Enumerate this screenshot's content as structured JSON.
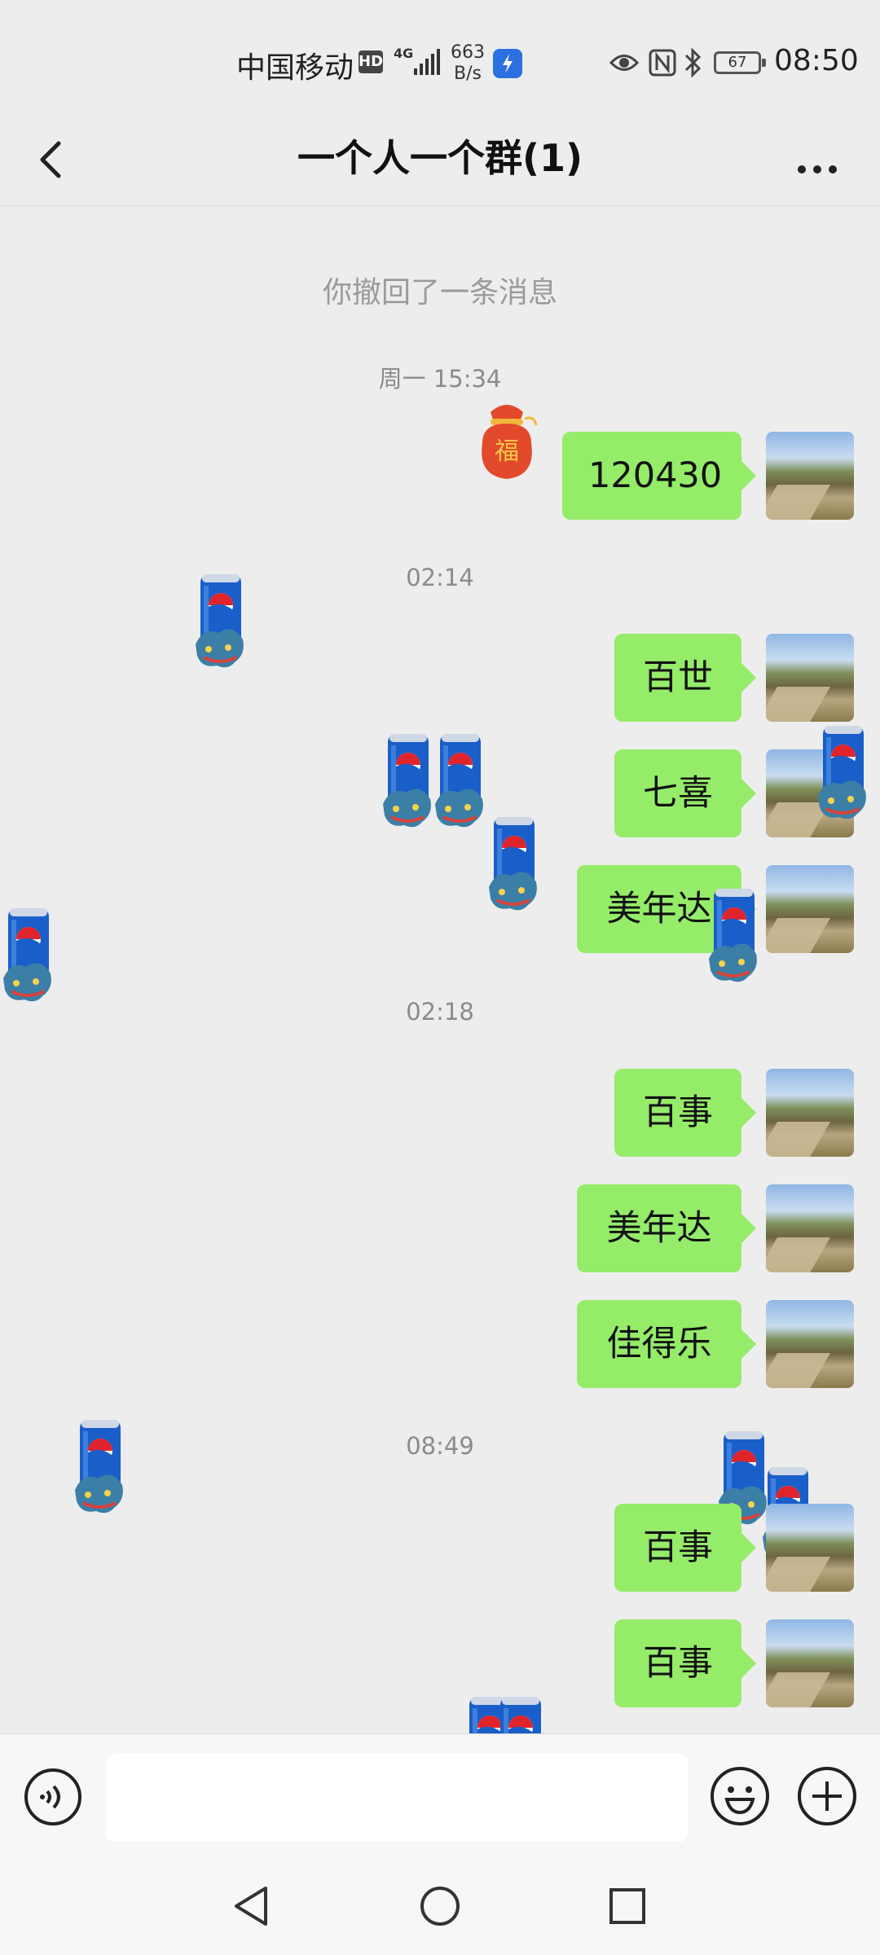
{
  "status": {
    "carrier": "中国移动",
    "hd": "HD",
    "network": "4G",
    "speed_value": "663",
    "speed_unit": "B/s",
    "battery": "67",
    "time": "08:50"
  },
  "header": {
    "title": "一个人一个群(1)"
  },
  "chat": {
    "recall_notice": "你撤回了一条消息",
    "timestamps": [
      "周一 15:34",
      "02:14",
      "02:18",
      "08:49"
    ],
    "messages": [
      "120430",
      "百世",
      "七喜",
      "美年达",
      "百事",
      "美年达",
      "佳得乐",
      "百事",
      "百事"
    ]
  },
  "colors": {
    "bubble": "#95ec69",
    "background": "#ededed",
    "pepsi_blue": "#1a5ec9"
  },
  "icons": [
    "back-arrow-icon",
    "more-dots-icon",
    "voice-icon",
    "emoji-icon",
    "plus-icon",
    "lucky-bag-icon",
    "pepsi-can-sticker"
  ]
}
